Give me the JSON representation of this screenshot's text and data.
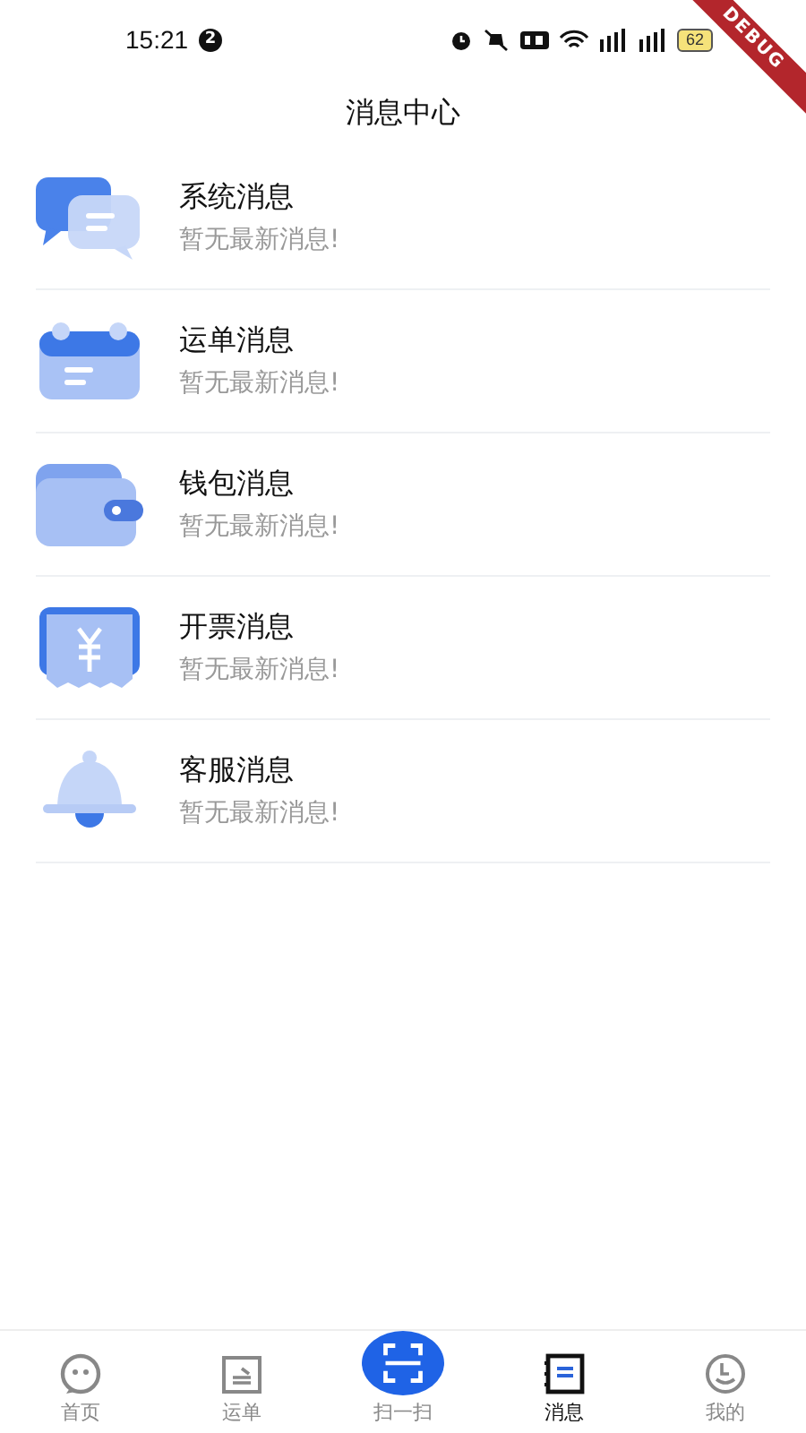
{
  "status_bar": {
    "time": "15:21",
    "notification_count": "2",
    "battery": "62"
  },
  "debug_banner": "DEBUG",
  "title": "消息中心",
  "messages": [
    {
      "kind": "chat",
      "title": "系统消息",
      "subtitle": "暂无最新消息!"
    },
    {
      "kind": "calendar",
      "title": "运单消息",
      "subtitle": "暂无最新消息!"
    },
    {
      "kind": "wallet",
      "title": "钱包消息",
      "subtitle": "暂无最新消息!"
    },
    {
      "kind": "invoice",
      "title": "开票消息",
      "subtitle": "暂无最新消息!"
    },
    {
      "kind": "bell",
      "title": "客服消息",
      "subtitle": "暂无最新消息!"
    }
  ],
  "tab_bar": [
    {
      "kind": "home",
      "label": "首页",
      "selected": false
    },
    {
      "kind": "waybill",
      "label": "运单",
      "selected": false
    },
    {
      "kind": "scan",
      "label": "扫一扫",
      "selected": false
    },
    {
      "kind": "message",
      "label": "消息",
      "selected": true
    },
    {
      "kind": "profile",
      "label": "我的",
      "selected": false
    }
  ]
}
